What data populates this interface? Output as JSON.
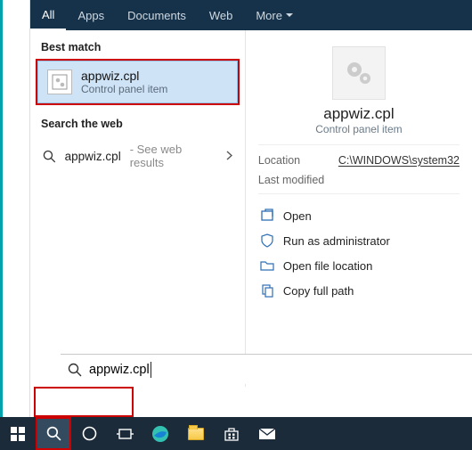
{
  "tabs": {
    "all": "All",
    "apps": "Apps",
    "documents": "Documents",
    "web": "Web",
    "more": "More"
  },
  "sections": {
    "best_match": "Best match",
    "search_web": "Search the web"
  },
  "best": {
    "title": "appwiz.cpl",
    "subtitle": "Control panel item"
  },
  "web": {
    "label": "appwiz.cpl",
    "hint": "- See web results"
  },
  "details": {
    "title": "appwiz.cpl",
    "subtitle": "Control panel item",
    "location_key": "Location",
    "location_val": "C:\\WINDOWS\\system32",
    "modified_key": "Last modified",
    "modified_val": ""
  },
  "actions": {
    "open": "Open",
    "run_admin": "Run as administrator",
    "open_loc": "Open file location",
    "copy_path": "Copy full path"
  },
  "search": {
    "value": "appwiz.cpl"
  }
}
